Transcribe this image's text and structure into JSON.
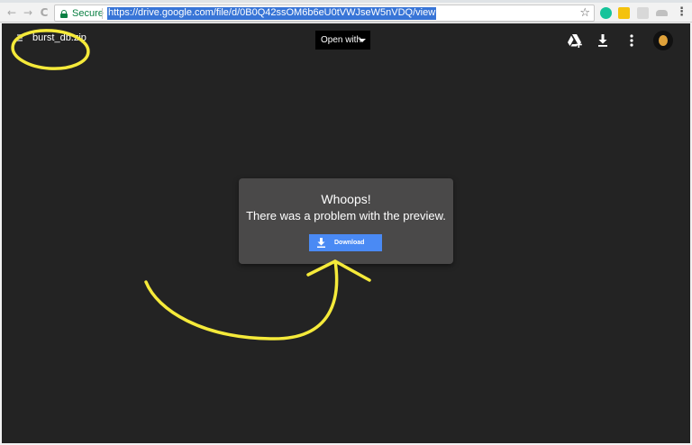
{
  "browser": {
    "back_glyph": "←",
    "forward_glyph": "→",
    "reload_glyph": "C",
    "security_label": "Secure",
    "url": "https://drive.google.com/file/d/0B0Q42ssOM6b6eU0tVWJseW5nVDQ/view",
    "star_glyph": "☆",
    "menu_glyph": "⋮",
    "extensions": [
      {
        "name": "grammarly-extension-icon",
        "color": "#15c39a"
      },
      {
        "name": "keep-extension-icon",
        "color": "#f4c20d"
      },
      {
        "name": "translate-extension-icon",
        "color": "#cfcfcf"
      },
      {
        "name": "shoe-extension-icon",
        "color": "#c0c0c0"
      }
    ]
  },
  "viewer": {
    "file_name": "burst_db.zip",
    "open_with_label": "Open with",
    "background_color": "#232323"
  },
  "preview_error": {
    "title": "Whoops!",
    "message": "There was a problem with the preview.",
    "download_label": "Download",
    "accent": "#4a8af4"
  },
  "annotation_color": "#f5ea3a"
}
